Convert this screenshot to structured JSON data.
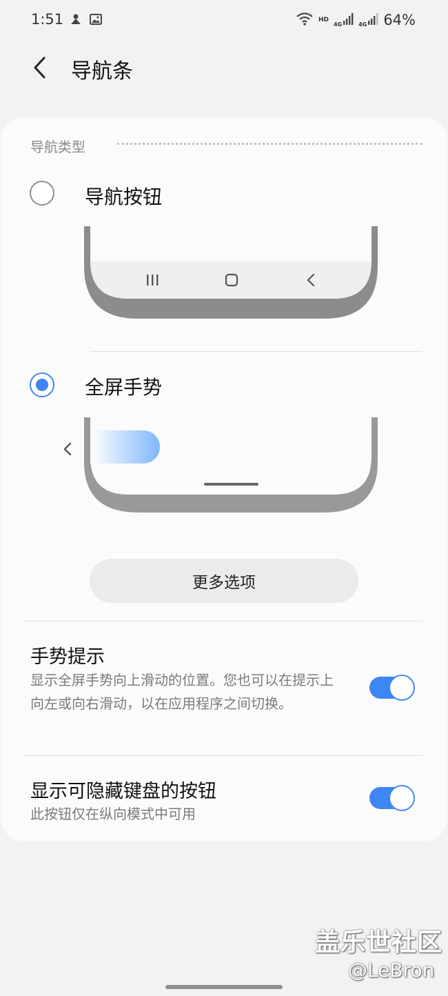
{
  "status_bar": {
    "time": "1:51",
    "hd_label": "HD",
    "network_label": "4G",
    "battery": "64%",
    "icons": [
      "notification-icon",
      "gallery-icon",
      "wifi-icon",
      "signal-icon",
      "signal-icon"
    ]
  },
  "header": {
    "back_icon": "chevron-left-icon",
    "title": "导航条"
  },
  "navigation_type": {
    "section_title": "导航类型",
    "options": [
      {
        "label": "导航按钮",
        "selected": false
      },
      {
        "label": "全屏手势",
        "selected": true
      }
    ],
    "preview_buttons_icons": [
      "recents-icon",
      "home-icon",
      "back-icon"
    ],
    "more_options_label": "更多选项"
  },
  "settings": {
    "gesture_hint": {
      "title": "手势提示",
      "description": "显示全屏手势向上滑动的位置。您也可以在提示上向左或向右滑动，以在应用程序之间切换。",
      "enabled": true
    },
    "keyboard_hide_button": {
      "title": "显示可隐藏键盘的按钮",
      "description": "此按钮仅在纵向模式中可用",
      "enabled": true
    }
  },
  "watermark": {
    "line1": "盖乐世社区",
    "line2": "@LeBron"
  },
  "colors": {
    "accent": "#3f86f5",
    "background": "#f2f2f2",
    "card": "#fbfbfb"
  }
}
